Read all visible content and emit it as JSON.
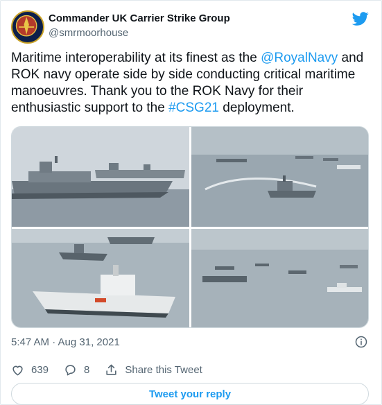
{
  "author": {
    "display_name": "Commander UK Carrier Strike Group",
    "handle": "@smrmoorhouse",
    "avatar_icon": "naval-crest-icon"
  },
  "tweet": {
    "text_parts": {
      "p1": "Maritime interoperability at its finest as the ",
      "mention": "@RoyalNavy",
      "p2": " and ROK navy operate side by side conducting critical maritime manoeuvres. Thank you to the ROK Navy for their enthusiastic support to the ",
      "hashtag": "#CSG21",
      "p3": " deployment."
    },
    "timestamp": "5:47 AM · Aug 31, 2021"
  },
  "actions": {
    "like_count": "639",
    "reply_count": "8",
    "share_label": "Share this Tweet"
  },
  "reply_button_label": "Tweet your reply",
  "colors": {
    "accent": "#1d9bf0",
    "text": "#0f1419",
    "muted": "#536471",
    "border": "#cfd9de"
  }
}
